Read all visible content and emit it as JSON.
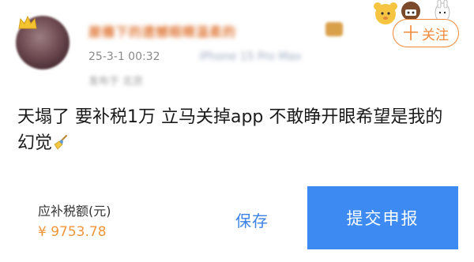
{
  "post": {
    "username": "屋檐下的遗憾眼睛温柔的",
    "time": "25-3-1 00:32",
    "device": "iPhone 15 Pro Max",
    "ip_location": "发布于 北京",
    "follow_label": "关注",
    "follow_plus": "十",
    "content": "天塌了 要补税1万 立马关掉app 不敢睁开眼希望是我的幻觉"
  },
  "tax_form": {
    "label": "应补税额(元)",
    "amount": "¥ 9753.78",
    "save_label": "保存",
    "submit_label": "提交申报"
  },
  "colors": {
    "accent_orange": "#f08a3a",
    "amount_orange": "#f0953a",
    "primary_blue": "#3d8bf2",
    "save_blue": "#3a82e6"
  },
  "icons": {
    "avatar_badge": "crown-icon",
    "corner_mascot": "mascot-sticker-icon",
    "content_emoji": "broom-emoji-icon"
  }
}
